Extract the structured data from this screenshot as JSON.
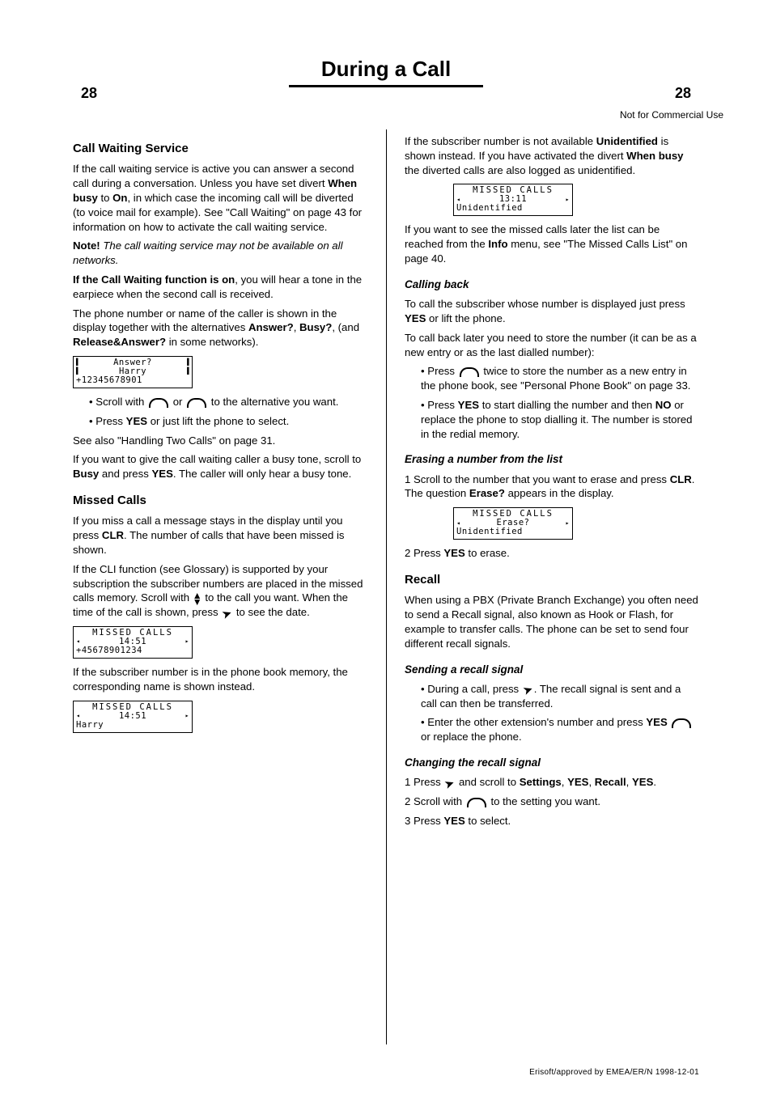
{
  "header": {
    "title": "During a Call",
    "page_number_left": "28",
    "page_number_right": "28",
    "page_label_right": "Not for Commercial Use"
  },
  "left": {
    "h_call_waiting": "Call Waiting Service",
    "p_cw_1": "If the call waiting service is active you can answer a second call during a conversation. Unless you have set divert ",
    "p_cw_1_strong": "When busy",
    "p_cw_1_cont": " to ",
    "p_cw_1_strong2": "On",
    "p_cw_1_cont2": ", in which case the incoming call will be diverted (to voice mail for example). See \"Call Waiting\" on page 43 for information on how to activate the call waiting service.",
    "p_cw_note_strong": "Note!",
    "p_cw_note": " The call waiting service may not be available on all networks.",
    "p_cw_tone_strong": "If the Call Waiting function is on",
    "p_cw_tone": ", you will hear a tone in the earpiece when the second call is received.",
    "p_cw_display": "The phone number or name of the caller is shown in the display together with the alternatives ",
    "p_cw_answer": "Answer?",
    "p_cw_display2": ", ",
    "p_cw_busy": "Busy?",
    "p_cw_display3": ", (and ",
    "p_cw_release": "Release&Answer?",
    "p_cw_display4": " in some networks).",
    "lcd_answer": {
      "r1": "Answer?",
      "r2": "Harry",
      "r3": "+12345678901"
    },
    "bul_a": "Scroll with",
    "bul_a_end": " to the alternative you want.",
    "bul_b_lead": "Press ",
    "bul_b_yes": "YES",
    "bul_b_rest": " or just lift the phone to select.",
    "p_see_two": "See also \"Handling Two Calls\" on page 31.",
    "p_busy_tone": "If you want to give the call waiting caller a busy tone, scroll to ",
    "p_busy_strong": "Busy",
    "p_busy_rest": " and press ",
    "p_busy_yes": "YES",
    "p_busy_rest2": ". The caller will only hear a busy tone.",
    "h_missed": "Missed Calls",
    "p_missed_1": "If you miss a call a message stays in the display until you press ",
    "p_missed_clr": "CLR",
    "p_missed_1b": ". The number of calls that have been missed is shown.",
    "p_missed_2": "If the CLI function (see Glossary) is supported by your subscription the subscriber numbers are placed in the missed calls memory. Scroll with ",
    "p_missed_2b": " to the call you want. When the time of the call is shown, press ",
    "p_missed_2c": " to see the date.",
    "lcd_missed1": {
      "r1": "MISSED CALLS",
      "r2": "14:51",
      "r3": "+45678901234"
    },
    "p_missed_name": "If the subscriber number is in the phone book memory, the corresponding name is shown instead.",
    "lcd_missed2": {
      "r1": "MISSED CALLS",
      "r2": "14:51",
      "r3": "Harry"
    }
  },
  "right": {
    "p_unid": "If the subscriber number is not available ",
    "p_unid_strong": "Unidentified",
    "p_unid2": " is shown instead. If you have activated the divert ",
    "p_unid_busy": "When busy",
    "p_unid3": " the diverted calls are also logged as unidentified.",
    "lcd_unid": {
      "r1": "MISSED CALLS",
      "r2": "13:11",
      "r3": "Unidentified"
    },
    "p_later": "If you want to see the missed calls later the list can be reached from the ",
    "p_later_info": "Info",
    "p_later2": " menu, see \"The Missed Calls List\" on page 40.",
    "h_callback": "Calling back",
    "p_cb_1": "To call the subscriber whose number is displayed just press ",
    "p_cb_yes": "YES",
    "p_cb_1b": " or lift the phone.",
    "p_cb_2": "To call back later you need to store the number (it can be as a new entry or as the last dialled number):",
    "bul_cb1": "Press ",
    "bul_cb1_2": " twice to store the number as a new entry in the phone book, see \"Personal Phone Book\" on page 33.",
    "bul_cb2": "Press ",
    "bul_cb2_yes": "YES",
    "bul_cb2_2": " to start dialling the number and then ",
    "bul_cb2_no": "NO",
    "bul_cb2_3": " or replace the phone to stop dialling it. The number is stored in the redial memory.",
    "h_erase": "Erasing a number from the list",
    "p_er_1a": "1 Scroll to the number that you want to erase and press ",
    "p_er_clr": "CLR",
    "p_er_1b": ". The question ",
    "p_er_erase": "Erase?",
    "p_er_1c": " appears in the display.",
    "lcd_erase": {
      "r1": "MISSED CALLS",
      "r2": "Erase?",
      "r3": "Unidentified"
    },
    "p_er_2a": "2 Press ",
    "p_er_yes": "YES",
    "p_er_2b": " to erase.",
    "h_recall": "Recall",
    "p_rc_1": "When using a PBX (Private Branch Exchange) you often need to send a Recall signal, also known as Hook or Flash, for example to transfer calls. The phone can be set to send four different recall signals.",
    "h_send": "Sending a recall signal",
    "bul_rc_a": "During a call, press ",
    "bul_rc_a2": ". The recall signal is sent and a call can then be transferred.",
    "bul_rc_b": "Enter the other extension's number and press ",
    "bul_rc_b_yes": "YES",
    "bul_rc_b2": " or replace the phone.",
    "h_change": "Changing the recall signal",
    "bul_ch_1a": "1 Press ",
    "bul_ch_1b": " and scroll to ",
    "bul_ch_1_set": "Settings",
    "bul_ch_1c": ", ",
    "bul_ch_1_yes": "YES",
    "bul_ch_1d": ", ",
    "bul_ch_1_re": "Recall",
    "bul_ch_1e": ", ",
    "bul_ch_1_yes2": "YES",
    "bul_ch_1f": ".",
    "bul_ch_2a": "2 Scroll with ",
    "bul_ch_2b": " to the setting you want.",
    "bul_ch_3a": "3 Press ",
    "bul_ch_3_yes": "YES",
    "bul_ch_3b": " to select."
  },
  "footer": {
    "note": "Erisoft/approved by EMEA/ER/N 1998-12-01"
  }
}
